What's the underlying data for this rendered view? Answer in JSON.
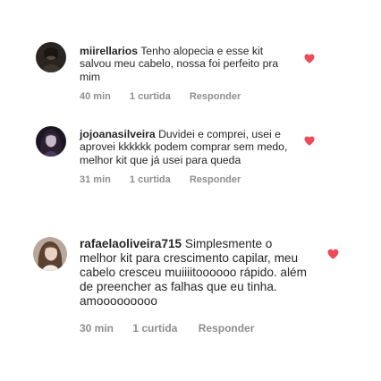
{
  "comments": [
    {
      "username": "miirellarios",
      "text": "Tenho alopecia e esse kit salvou meu cabelo, nossa foi perfeito pra mim",
      "time": "40 min",
      "likes": "1 curtida",
      "reply": "Responder",
      "liked": true
    },
    {
      "username": "jojoanasilveira",
      "text": "Duvidei e comprei, usei e aprovei kkkkkk podem comprar sem medo, melhor kit que já usei para queda",
      "time": "31 min",
      "likes": "1 curtida",
      "reply": "Responder",
      "liked": true
    },
    {
      "username": "rafaelaoliveira715",
      "text": "Simplesmente o melhor kit para crescimento capilar, meu cabelo cresceu muiiiitoooooo rápido. além de preencher as falhas que eu tinha. amooooooooo",
      "time": "30 min",
      "likes": "1 curtida",
      "reply": "Responder",
      "liked": true
    }
  ],
  "colors": {
    "heart": "#ed4956",
    "meta": "#8e8e8e",
    "text": "#262626"
  },
  "icons": {
    "like": "heart-icon",
    "avatar": "profile-photo"
  }
}
